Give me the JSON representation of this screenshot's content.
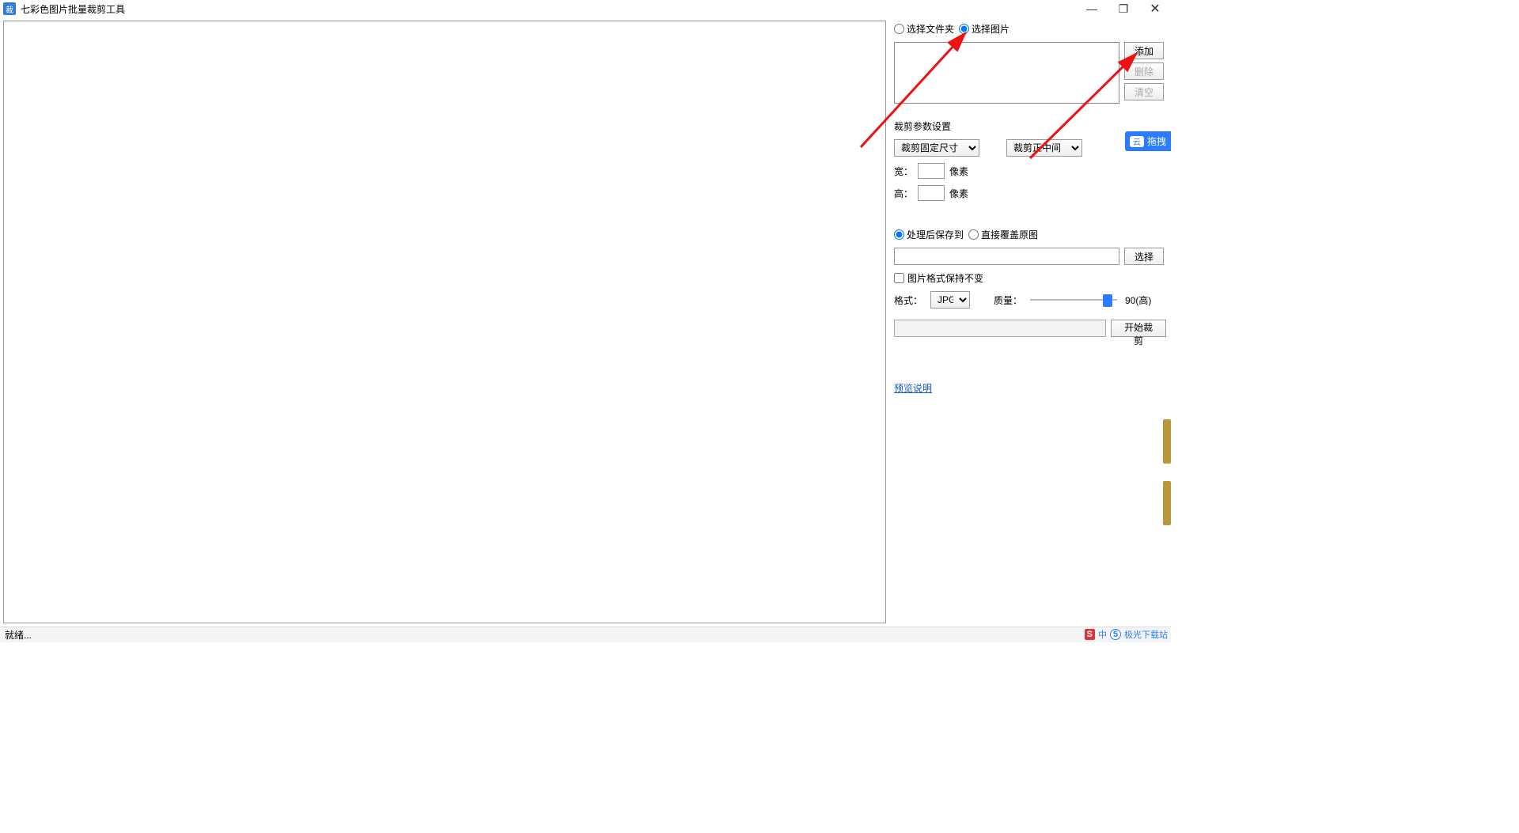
{
  "title": "七彩色图片批量裁剪工具",
  "win_controls": {
    "min": "—",
    "max": "❐",
    "close": "✕"
  },
  "source": {
    "folder_label": "选择文件夹",
    "image_label": "选择图片",
    "add": "添加",
    "delete": "删除",
    "clear": "清空"
  },
  "crop": {
    "section": "裁剪参数设置",
    "mode": "裁剪固定尺寸",
    "position": "裁剪正中间",
    "width_label": "宽：",
    "height_label": "高：",
    "px": "像素"
  },
  "cloud": {
    "text": "拖拽"
  },
  "save": {
    "save_to": "处理后保存到",
    "overwrite": "直接覆盖原图",
    "choose": "选择",
    "keep_format": "图片格式保持不变",
    "format_label": "格式：",
    "format": "JPG",
    "quality_label": "质量：",
    "quality_value": "90(高)",
    "start": "开始裁剪"
  },
  "preview_link": "预览说明",
  "status": "就绪...",
  "watermark": {
    "ime": "中",
    "site": "极光下载站"
  }
}
